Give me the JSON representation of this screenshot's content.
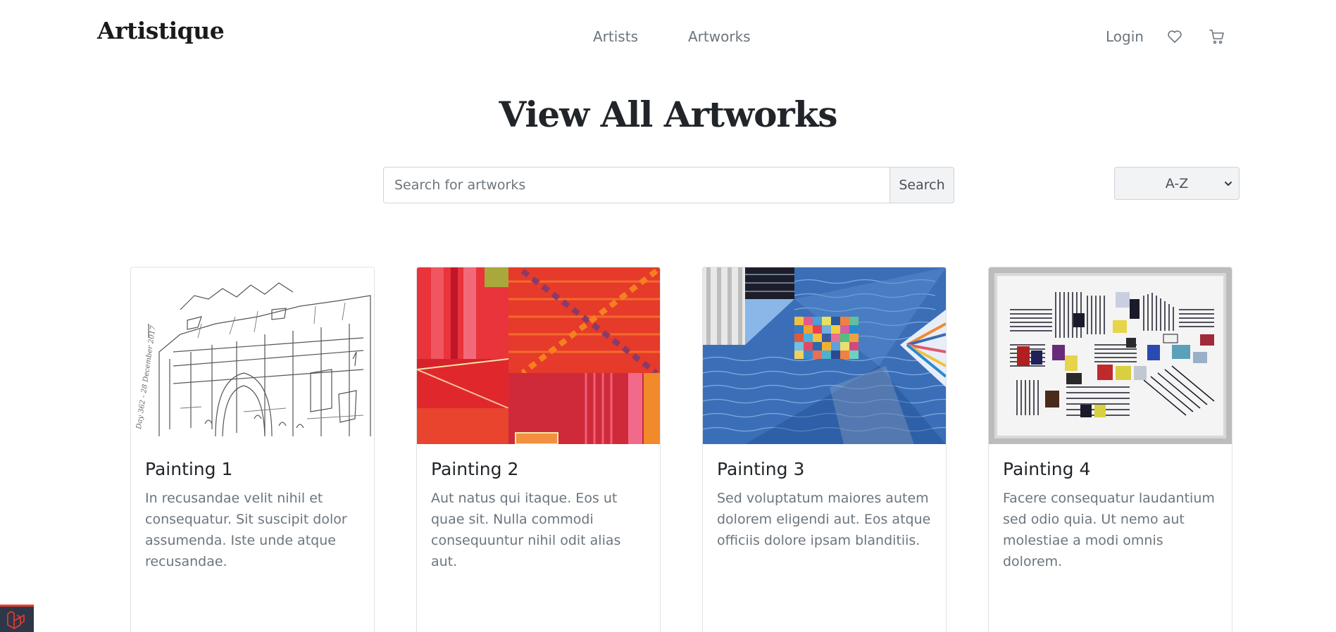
{
  "nav": {
    "brand": "Artistique",
    "links": [
      "Artists",
      "Artworks"
    ],
    "login": "Login",
    "icons": [
      "heart-icon",
      "cart-icon"
    ]
  },
  "main": {
    "title": "View All Artworks",
    "search": {
      "placeholder": "Search for artworks",
      "value": "",
      "button": "Search"
    },
    "sort": {
      "selected": "A-Z"
    }
  },
  "cards": [
    {
      "title": "Painting 1",
      "description": "In recusandae velit nihil et consequatur. Sit suscipit dolor assumenda. Iste unde atque recusandae.",
      "image": "sketch-artwork"
    },
    {
      "title": "Painting 2",
      "description": "Aut natus qui itaque. Eos ut quae sit. Nulla commodi consequuntur nihil odit alias aut.",
      "image": "red-geometric-artwork"
    },
    {
      "title": "Painting 3",
      "description": "Sed voluptatum maiores autem dolorem eligendi aut. Eos atque officiis dolore ipsam blanditiis.",
      "image": "blue-wave-artwork"
    },
    {
      "title": "Painting 4",
      "description": "Facere consequatur laudantium sed odio quia. Ut nemo aut molestiae a modi omnis dolorem.",
      "image": "striped-collage-artwork"
    }
  ],
  "colors": {
    "accent": "#ef3b2d",
    "text_muted": "#6c757d",
    "border": "#dee2e6"
  }
}
